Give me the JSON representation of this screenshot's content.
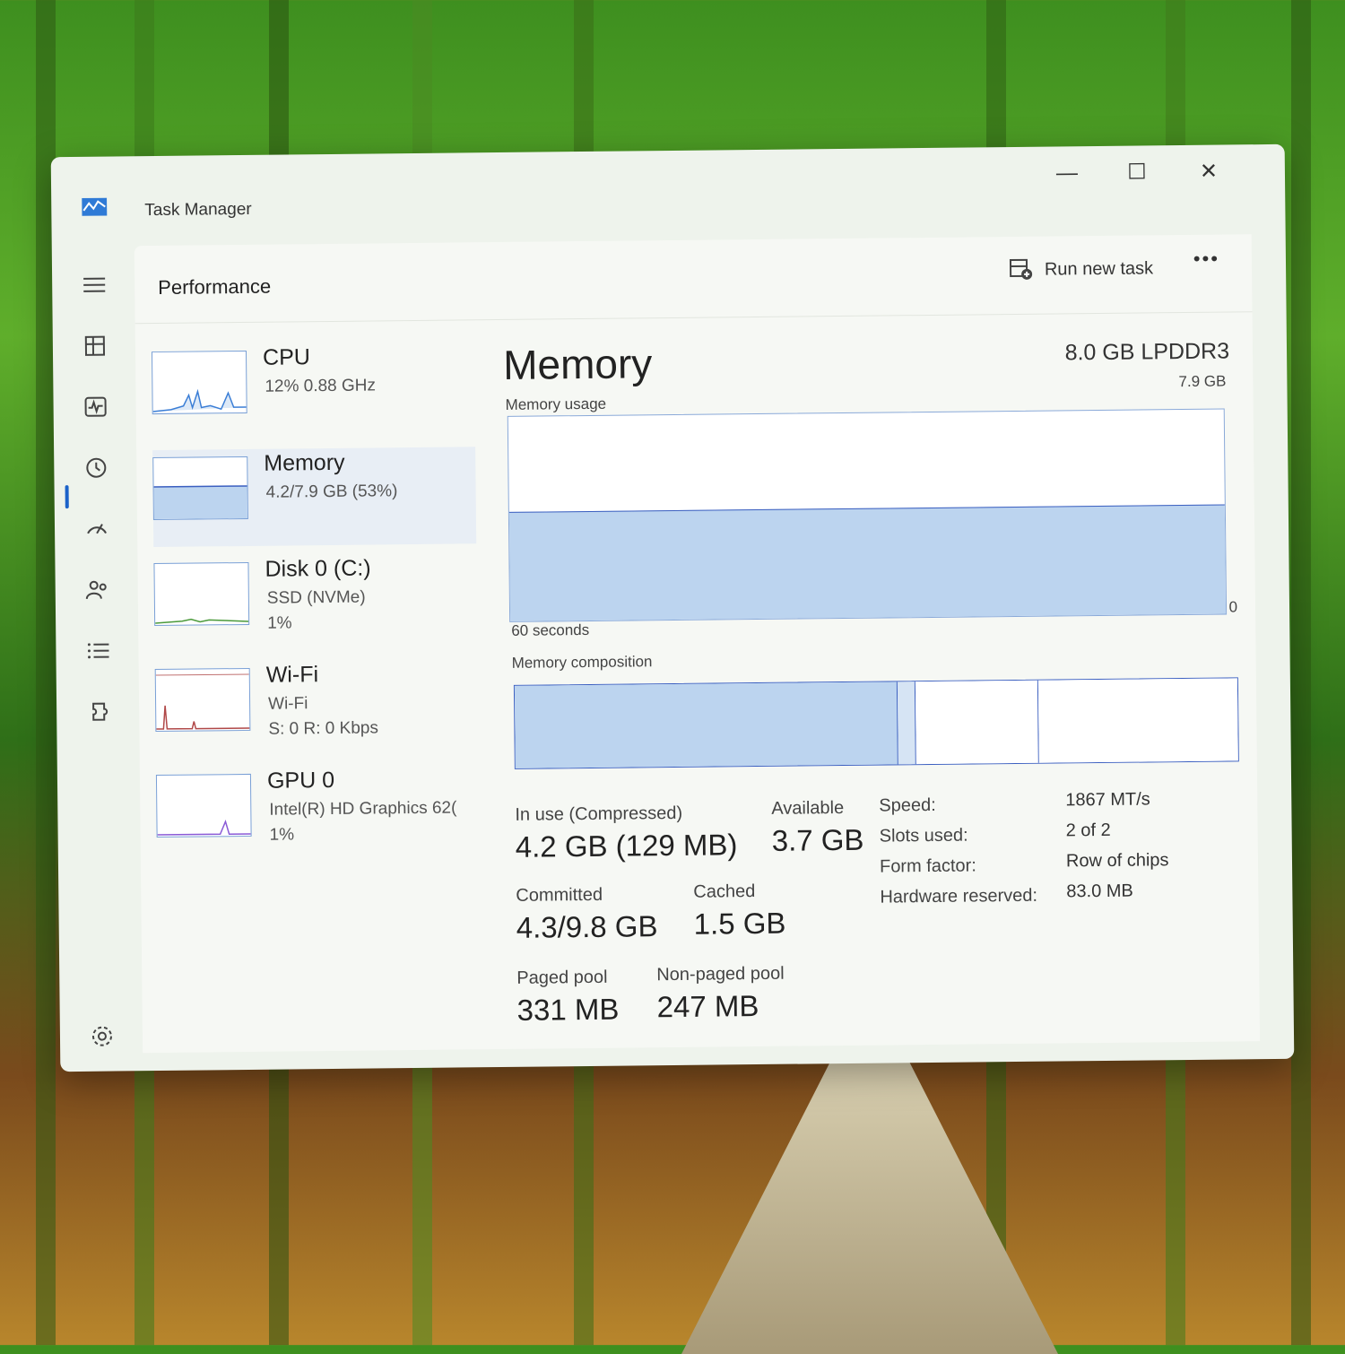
{
  "window": {
    "title": "Task Manager",
    "controls": {
      "minimize": "—",
      "maximize": "☐",
      "close": "✕"
    }
  },
  "nav": {
    "icons": [
      "hamburger-icon",
      "processes-icon",
      "performance-icon",
      "app-history-icon",
      "startup-icon",
      "users-icon",
      "details-icon",
      "services-icon",
      "settings-icon"
    ],
    "active": "performance-icon"
  },
  "header": {
    "title": "Performance",
    "run_new_task": "Run new task",
    "more": "•••"
  },
  "sidebar": {
    "items": [
      {
        "name": "CPU",
        "line1": "12%  0.88 GHz",
        "line2": ""
      },
      {
        "name": "Memory",
        "line1": "4.2/7.9 GB (53%)",
        "line2": ""
      },
      {
        "name": "Disk 0 (C:)",
        "line1": "SSD (NVMe)",
        "line2": "1%"
      },
      {
        "name": "Wi-Fi",
        "line1": "Wi-Fi",
        "line2": "S: 0  R: 0 Kbps"
      },
      {
        "name": "GPU 0",
        "line1": "Intel(R) HD Graphics 62(",
        "line2": "1%"
      }
    ]
  },
  "memory": {
    "title": "Memory",
    "type": "8.0 GB LPDDR3",
    "usage_label": "Memory usage",
    "usage_max": "7.9 GB",
    "time_label": "60 seconds",
    "usage_min": "0",
    "usage_fraction": 0.53,
    "composition_label": "Memory composition",
    "composition_fractions": {
      "in_use": 0.53,
      "modified": 0.025,
      "standby": 0.17,
      "free": 0.275
    },
    "stats": {
      "in_use_label": "In use (Compressed)",
      "in_use_value": "4.2 GB (129 MB)",
      "available_label": "Available",
      "available_value": "3.7 GB",
      "committed_label": "Committed",
      "committed_value": "4.3/9.8 GB",
      "cached_label": "Cached",
      "cached_value": "1.5 GB",
      "paged_label": "Paged pool",
      "paged_value": "331 MB",
      "nonpaged_label": "Non-paged pool",
      "nonpaged_value": "247 MB"
    },
    "details": {
      "speed_label": "Speed:",
      "speed_value": "1867 MT/s",
      "slots_label": "Slots used:",
      "slots_value": "2 of 2",
      "form_label": "Form factor:",
      "form_value": "Row of chips",
      "hw_label": "Hardware reserved:",
      "hw_value": "83.0 MB"
    }
  },
  "colors": {
    "accent": "#1b62c9",
    "graph_fill": "#bcd4ef",
    "graph_line": "#3b5fc0"
  }
}
